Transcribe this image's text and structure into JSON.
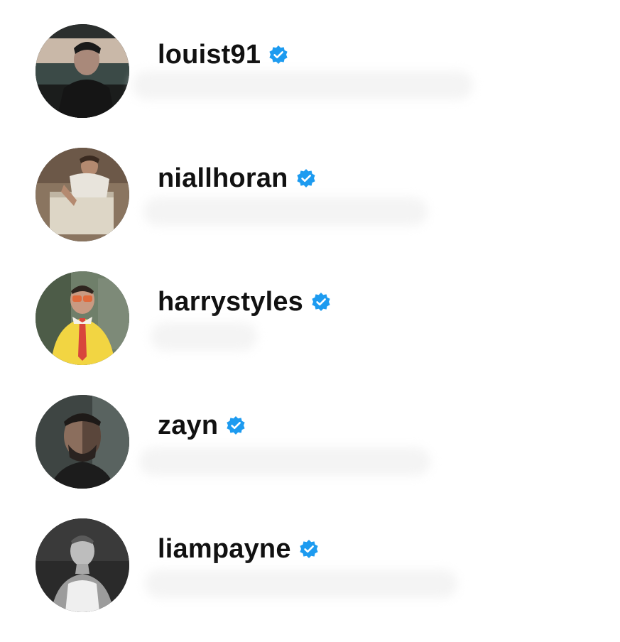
{
  "accounts": [
    {
      "username": "louist91",
      "verified": true,
      "verified_icon": "verified-badge-icon",
      "avatar_icon": "profile-photo",
      "subtitle": ""
    },
    {
      "username": "niallhoran",
      "verified": true,
      "verified_icon": "verified-badge-icon",
      "avatar_icon": "profile-photo",
      "subtitle": ""
    },
    {
      "username": "harrystyles",
      "verified": true,
      "verified_icon": "verified-badge-icon",
      "avatar_icon": "profile-photo",
      "subtitle": ""
    },
    {
      "username": "zayn",
      "verified": true,
      "verified_icon": "verified-badge-icon",
      "avatar_icon": "profile-photo",
      "subtitle": ""
    },
    {
      "username": "liampayne",
      "verified": true,
      "verified_icon": "verified-badge-icon",
      "avatar_icon": "profile-photo",
      "subtitle": ""
    }
  ],
  "colors": {
    "verified_blue": "#1d9bf0",
    "username_text": "#111111",
    "background": "#ffffff"
  }
}
